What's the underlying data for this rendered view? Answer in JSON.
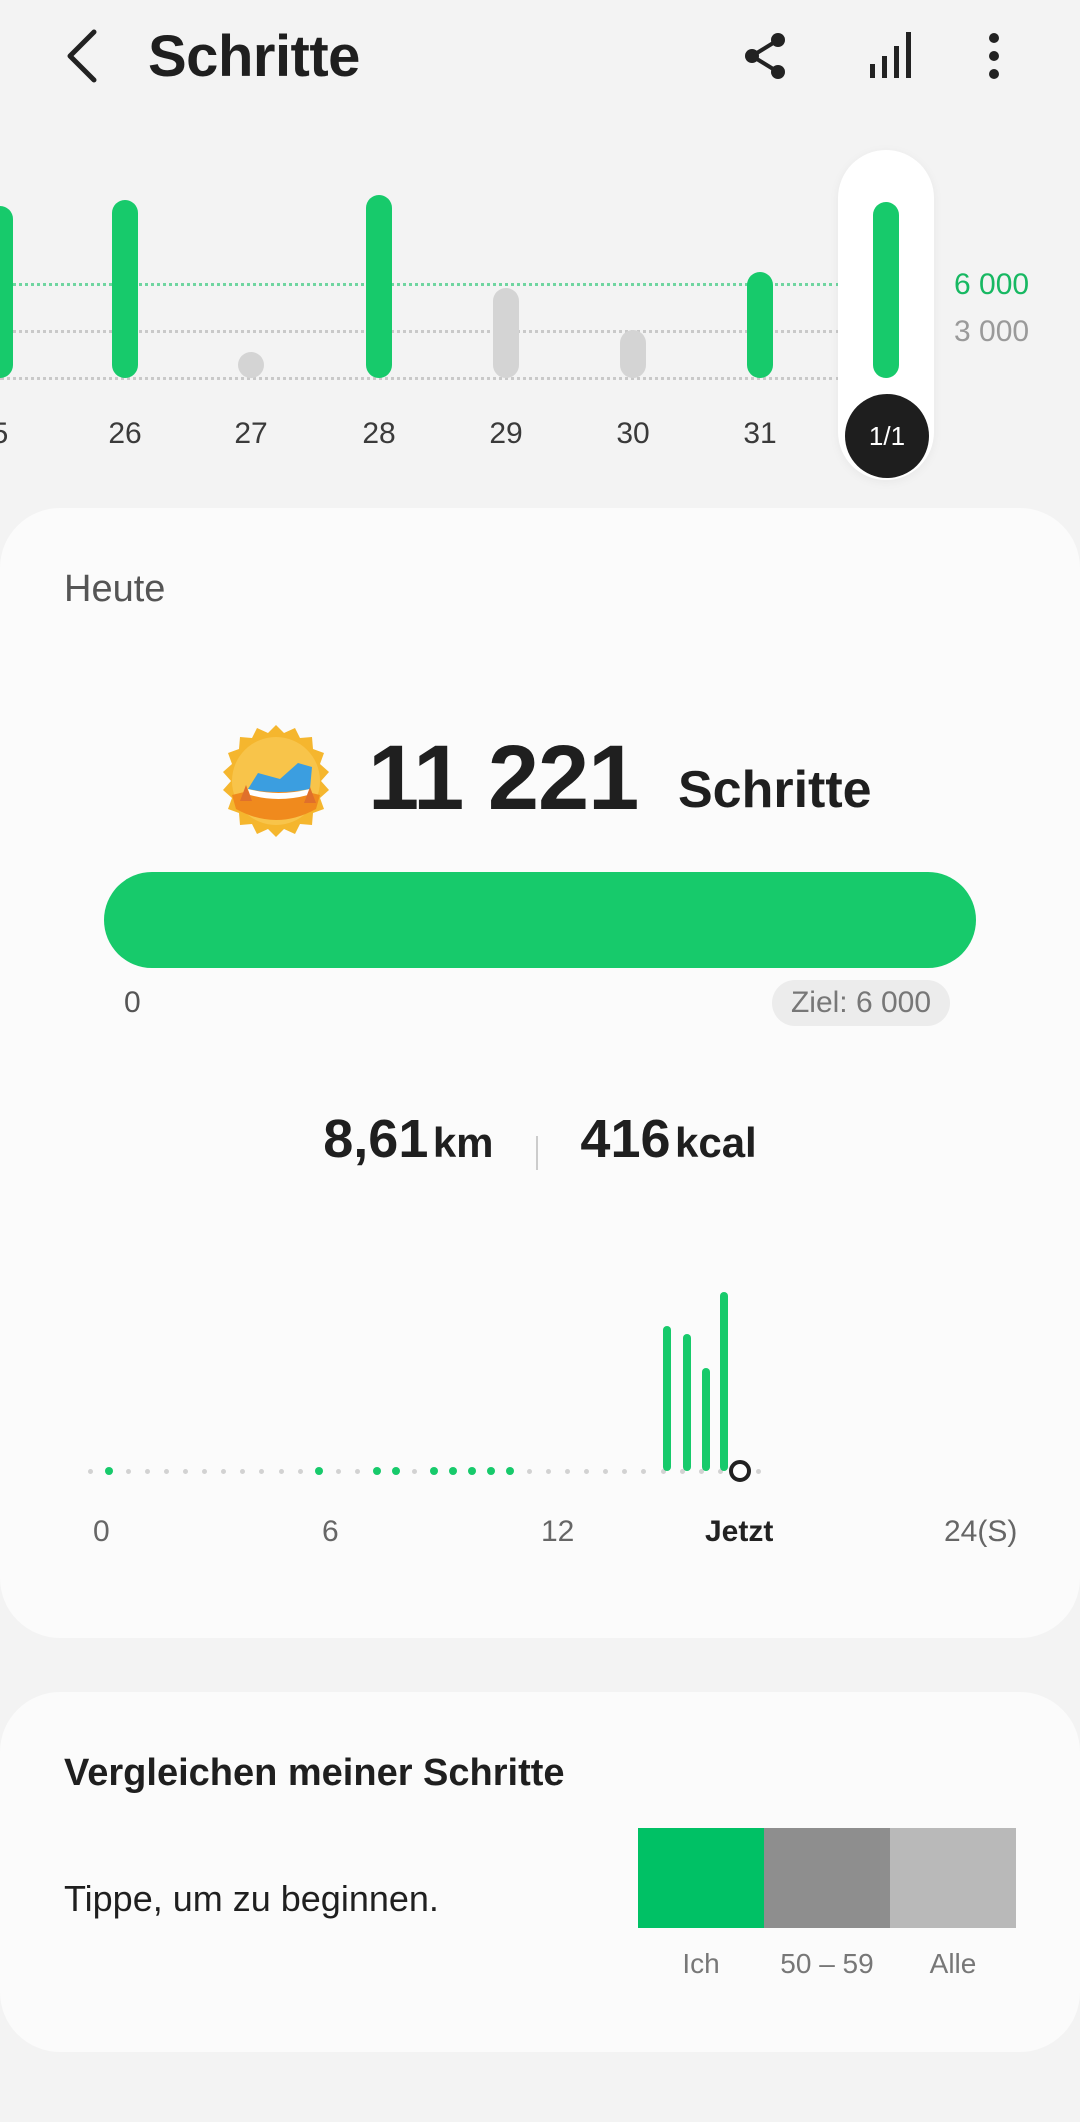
{
  "header": {
    "title": "Schritte",
    "icons": [
      "back-arrow-icon",
      "share-icon",
      "bar-chart-icon",
      "more-vert-icon"
    ]
  },
  "week": {
    "days": [
      {
        "label": "5",
        "value": "high",
        "color": "green"
      },
      {
        "label": "26",
        "value": "high",
        "color": "green"
      },
      {
        "label": "27",
        "value": "minimal",
        "color": "grey"
      },
      {
        "label": "28",
        "value": "high",
        "color": "green"
      },
      {
        "label": "29",
        "value": "low",
        "color": "grey"
      },
      {
        "label": "30",
        "value": "low",
        "color": "grey"
      },
      {
        "label": "31",
        "value": "goal",
        "color": "green"
      },
      {
        "label": "1/1",
        "value": "high",
        "color": "green",
        "selected": true
      }
    ],
    "goal_line_green": "6 000",
    "goal_line_grey": "3 000"
  },
  "today": {
    "heading": "Heute",
    "steps": "11 221",
    "steps_unit": "Schritte",
    "progress_fraction": 1.0,
    "progress_start": "0",
    "goal_label": "Ziel: 6 000",
    "distance_value": "8,61",
    "distance_unit": "km",
    "calories_value": "416",
    "calories_unit": "kcal",
    "hourly_axis": {
      "labels": [
        "0",
        "6",
        "12",
        "Jetzt",
        "24(S)"
      ]
    }
  },
  "compare": {
    "title": "Vergleichen meiner Schritte",
    "subtitle": "Tippe, um zu beginnen.",
    "segments": [
      {
        "label": "Ich",
        "color": "#00c165"
      },
      {
        "label": "50 – 59",
        "color": "#8e8e8e"
      },
      {
        "label": "Alle",
        "color": "#b9b9b9"
      }
    ]
  },
  "colors": {
    "accent_green": "#17ca6b",
    "background": "#f3f3f3"
  }
}
